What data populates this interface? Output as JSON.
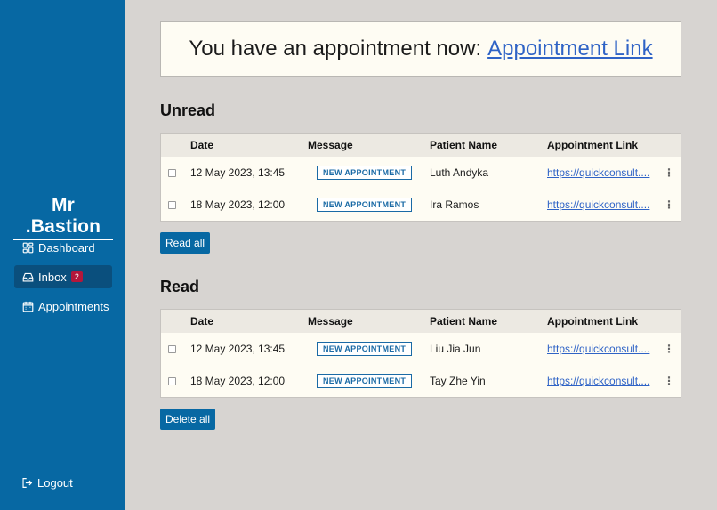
{
  "sidebar": {
    "brand": "Mr .Bastion",
    "items": [
      {
        "label": "Dashboard",
        "icon": "dashboard-icon"
      },
      {
        "label": "Inbox",
        "icon": "inbox-icon",
        "badge": "2",
        "active": true
      },
      {
        "label": "Appointments",
        "icon": "calendar-icon"
      }
    ],
    "logout_label": "Logout"
  },
  "banner": {
    "text": "You have an appointment now:",
    "link_label": "Appointment Link"
  },
  "columns": {
    "date": "Date",
    "message": "Message",
    "patient": "Patient Name",
    "link": "Appointment Link"
  },
  "unread": {
    "title": "Unread",
    "rows": [
      {
        "date": "12 May 2023, 13:45",
        "message": "NEW APPOINTMENT",
        "patient": "Luth Andyka",
        "link": "https://quickconsult...."
      },
      {
        "date": "18 May 2023, 12:00",
        "message": "NEW APPOINTMENT",
        "patient": "Ira Ramos",
        "link": "https://quickconsult...."
      }
    ],
    "action_label": "Read all"
  },
  "read": {
    "title": "Read",
    "rows": [
      {
        "date": "12 May 2023, 13:45",
        "message": "NEW APPOINTMENT",
        "patient": "Liu Jia Jun",
        "link": "https://quickconsult...."
      },
      {
        "date": "18 May 2023, 12:00",
        "message": "NEW APPOINTMENT",
        "patient": "Tay Zhe Yin",
        "link": "https://quickconsult...."
      }
    ],
    "action_label": "Delete all"
  },
  "colors": {
    "sidebar": "#0768a3",
    "sidebar_active": "#0a4f7d",
    "background": "#d7d4d1",
    "panel": "#fefcf3",
    "link": "#2f63c6",
    "badge": "#b3173b"
  }
}
